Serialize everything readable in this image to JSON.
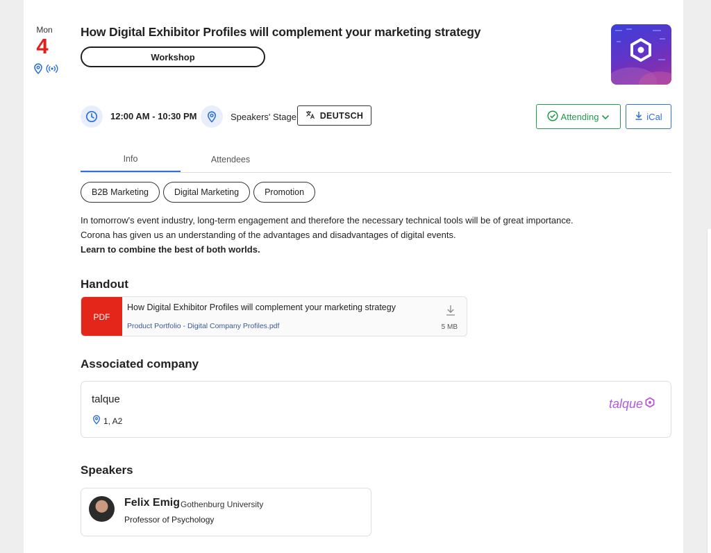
{
  "date": {
    "weekday": "Mon",
    "day": "4"
  },
  "session": {
    "title": "How Digital Exhibitor Profiles will complement your marketing strategy",
    "type": "Workshop",
    "time": "12:00 AM - 10:30 PM",
    "location": "Speakers' Stage",
    "language": "DEUTSCH"
  },
  "actions": {
    "attending": "Attending",
    "ical": "iCal"
  },
  "tabs": [
    "Info",
    "Attendees"
  ],
  "tags": [
    "B2B Marketing",
    "Digital Marketing",
    "Promotion"
  ],
  "description": {
    "line1": "In tomorrow's event industry, long-term engagement and therefore the necessary technical tools will be of great importance.",
    "line2": "Corona has given us an understanding of the advantages and disadvantages of digital events.",
    "line3": "Learn to combine the best of both worlds."
  },
  "handout": {
    "heading": "Handout",
    "badge": "PDF",
    "title": "How Digital Exhibitor Profiles will complement your marketing strategy",
    "filename": "Product Portfolio - Digital Company Profiles.pdf",
    "size": "5 MB"
  },
  "company": {
    "heading": "Associated company",
    "name": "talque",
    "location": "1, A2",
    "logo_text": "talque"
  },
  "speakers": {
    "heading": "Speakers",
    "items": [
      {
        "name": "Felix Emig",
        "org": "Gothenburg University",
        "role": "Professor of Psychology"
      }
    ]
  },
  "colors": {
    "accent_blue": "#2f6fdc",
    "attending_green": "#1e9c4a",
    "date_red": "#e0201b",
    "pdf_red": "#e32619",
    "logo_purple": "#b25bd8"
  },
  "icons": [
    "location-pin-icon",
    "live-stream-icon",
    "clock-icon",
    "translate-icon",
    "check-circle-icon",
    "chevron-down-icon",
    "download-icon"
  ]
}
